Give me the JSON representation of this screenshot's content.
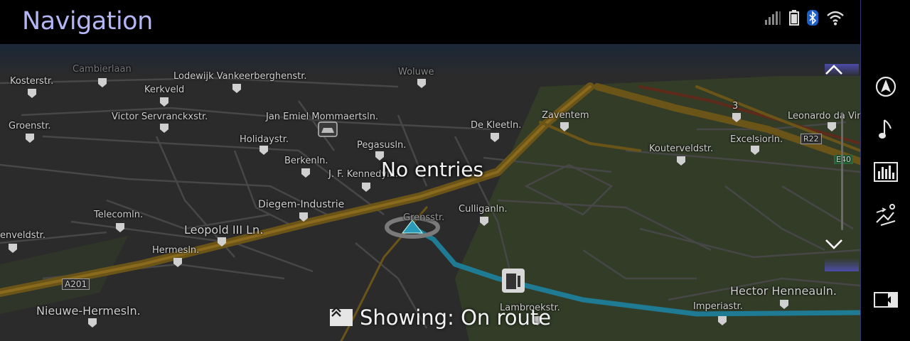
{
  "header": {
    "title": "Navigation"
  },
  "status_icons": [
    "signal-icon",
    "battery-icon",
    "bluetooth-icon",
    "wifi-icon"
  ],
  "map": {
    "message": "No entries",
    "showing": "Showing: On route",
    "labels": {
      "kosterstr": "Kosterstr.",
      "cambierlaan": "Cambierlaan",
      "lodewijk": "Lodewijk Vankeerberghenstr.",
      "woluwe": "Woluwe",
      "kerkveld": "Kerkveld",
      "victor": "Victor Servranckxstr.",
      "jan_emiel": "Jan Emiel Mommaertsln.",
      "zaventem": "Zaventem",
      "groenstr": "Groenstr.",
      "holidaystr": "Holidaystr.",
      "dekleetln": "De Kleetln.",
      "pegasusln": "Pegasusln.",
      "kouterveldstr": "Kouterveldstr.",
      "excelsiorln": "Excelsiorln.",
      "leonardo": "Leonardo da Vin",
      "r22": "R22",
      "e40": "E40",
      "exit3": "3",
      "berkenln": "Berkenln.",
      "jfkennedy": "J. F. Kennedyln.",
      "diegem": "Diegem-Industrie",
      "culliganln": "Culliganln.",
      "grensstr": "Grensstr.",
      "telecomln": "Telecomln.",
      "leopold": "Leopold III Ln.",
      "enveldstr": "enveldstr.",
      "hermesln": "Hermesln.",
      "a201": "A201",
      "nieuwe": "Nieuwe-Hermesln.",
      "hector": "Hector Henneauln.",
      "imperiastr": "Imperiastr.",
      "lambroekstr": "Lambroekstr."
    }
  },
  "sidebar": {
    "items": [
      "navigation-icon",
      "music-note-icon",
      "equalizer-icon",
      "seat-climate-icon",
      "screen-split-icon"
    ]
  },
  "colors": {
    "accent": "#b4b6f4",
    "highway": "#6b5418",
    "route": "#1f7a93",
    "grass": "#323c27",
    "road": "#4a4a4a"
  }
}
